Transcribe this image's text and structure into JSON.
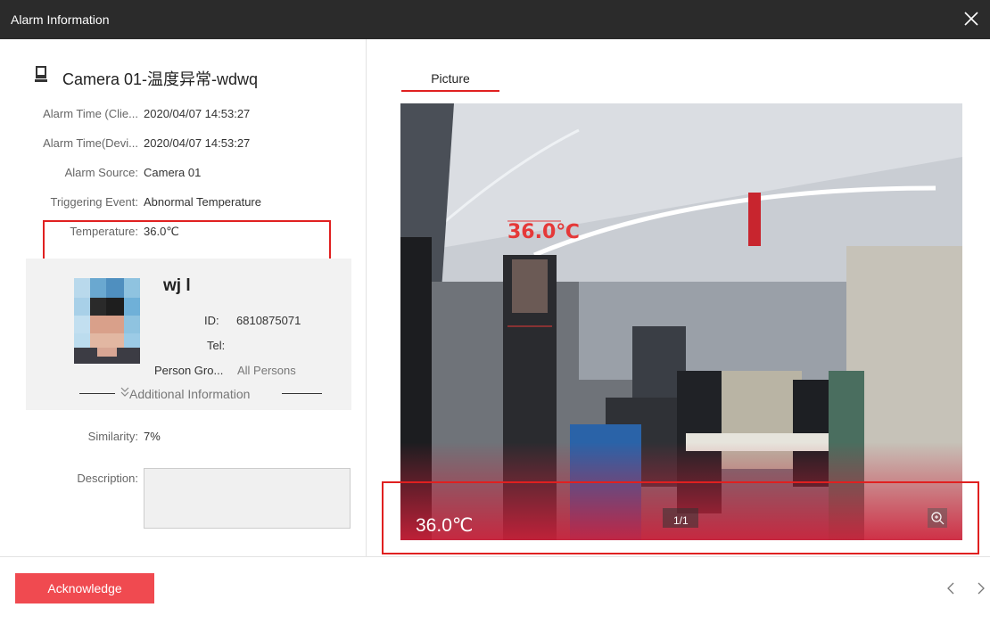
{
  "window": {
    "title": "Alarm Information"
  },
  "camera": {
    "name": "Camera 01-温度异常-wdwq"
  },
  "fields": [
    {
      "label": "Alarm Time (Clie...",
      "value": "2020/04/07 14:53:27"
    },
    {
      "label": "Alarm Time(Devi...",
      "value": "2020/04/07 14:53:27"
    },
    {
      "label": "Alarm Source:",
      "value": "Camera 01"
    },
    {
      "label": "Triggering Event:",
      "value": "Abnormal Temperature"
    },
    {
      "label": "Temperature:",
      "value": "36.0℃"
    }
  ],
  "person": {
    "name": "wj l",
    "id_label": "ID:",
    "id_value": "6810875071",
    "tel_label": "Tel:",
    "group_label": "Person Gro...",
    "group_value": "All Persons",
    "additional_info": "Additional Information"
  },
  "similarity": {
    "label": "Similarity:",
    "value": "7%"
  },
  "description": {
    "label": "Description:",
    "value": ""
  },
  "picture": {
    "tab_label": "Picture",
    "overlay_temp": "36.0℃",
    "bottom_temp": "36.0℃",
    "counter": "1/1"
  },
  "footer": {
    "acknowledge_label": "Acknowledge"
  },
  "colors": {
    "accent": "#f04a50",
    "titlebar": "#2b2b2b",
    "highlight_box": "#e02020"
  }
}
